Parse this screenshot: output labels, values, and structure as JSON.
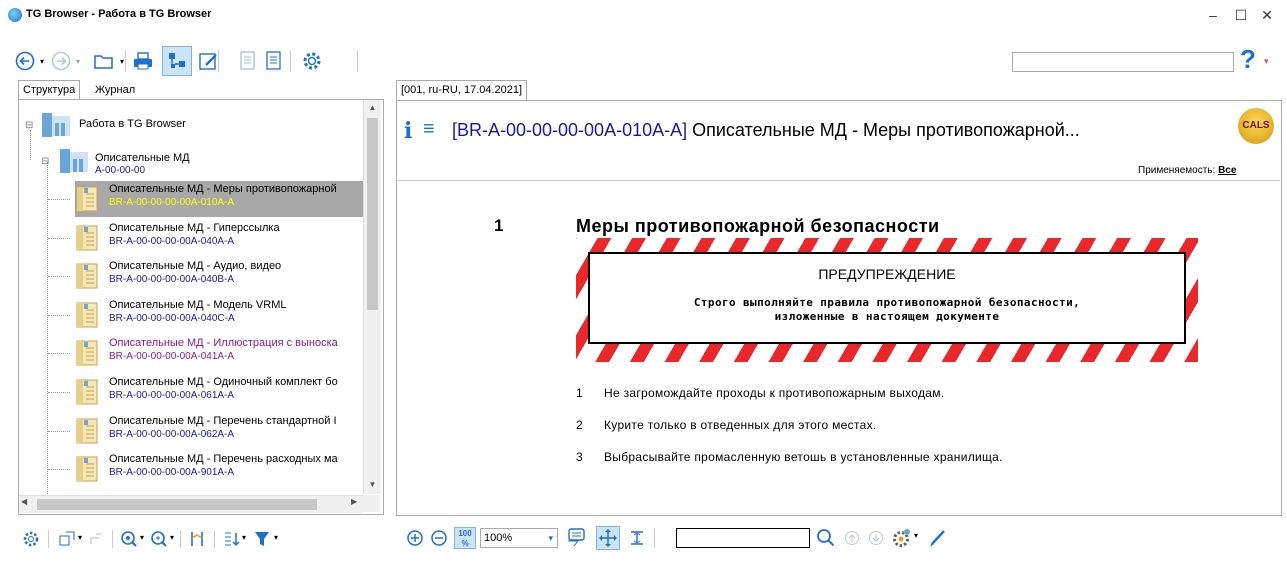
{
  "window": {
    "title": "TG Browser - Работа в TG Browser",
    "controls": {
      "minimize": "–",
      "maximize": "☐",
      "close": "✕"
    }
  },
  "toolbar": {
    "search_value": "",
    "help_label": "?"
  },
  "left_panel": {
    "tabs": [
      {
        "label": "Структура",
        "active": true
      },
      {
        "label": "Журнал",
        "active": false
      }
    ],
    "tree": {
      "root": {
        "label": "Работа в TG Browser",
        "expander": "⊟"
      },
      "folder": {
        "label": "Описательные МД",
        "code": "A-00-00-00",
        "expander": "⊟"
      },
      "items": [
        {
          "label": "Описательные МД - Меры противопожарной",
          "code": "BR-A-00-00-00-00A-010A-A",
          "selected": true
        },
        {
          "label": "Описательные МД - Гиперссылка",
          "code": "BR-A-00-00-00-00A-040A-A",
          "selected": false
        },
        {
          "label": "Описательные МД - Аудио, видео",
          "code": "BR-A-00-00-00-00A-040B-A",
          "selected": false
        },
        {
          "label": "Описательные МД - Модель VRML",
          "code": "BR-A-00-00-00-00A-040C-A",
          "selected": false
        },
        {
          "label": "Описательные МД - Иллюстрация с выноска",
          "code": "BR-A-00-00-00-00A-041A-A",
          "selected": false,
          "visited": true
        },
        {
          "label": "Описательные МД - Одиночный комплект бо",
          "code": "BR-A-00-00-00-00A-061A-A",
          "selected": false
        },
        {
          "label": "Описательные МД - Перечень стандартной I",
          "code": "BR-A-00-00-00-00A-062A-A",
          "selected": false
        },
        {
          "label": "Описательные МД - Перечень расходных ма",
          "code": "BR-A-00-00-00-00A-901A-A",
          "selected": false
        }
      ]
    }
  },
  "document": {
    "tab_label": "[001, ru-RU, 17.04.2021]",
    "code": "[BR-A-00-00-00-00A-010A-A]",
    "title": "Описательные МД - Меры противопожарной...",
    "applicability_label": "Применяемость:",
    "applicability_value": "Все",
    "logo_text": "CALS",
    "section_number": "1",
    "section_title": "Меры противопожарной безопасности",
    "warning": {
      "title": "ПРЕДУПРЕЖДЕНИЕ",
      "line1": "Строго выполняйте правила противопожарной безопасности,",
      "line2": "изложенные в настоящем документе"
    },
    "paragraphs": [
      {
        "num": "1",
        "text": "Не загромождайте проходы к противопожарным выходам."
      },
      {
        "num": "2",
        "text": "Курите только в отведенных для этого местах."
      },
      {
        "num": "3",
        "text": "Выбрасывайте промасленную ветошь в установленные хранилища."
      }
    ]
  },
  "viewer_toolbar": {
    "zoom_value": "100%",
    "fit_label": "100 %",
    "search_value": ""
  },
  "colors": {
    "selection": "#a8a8a8",
    "selected_code": "#ffff00",
    "code_blue": "#1a1aa0",
    "visited": "#8b1a8b",
    "hazard_red": "#e8282b",
    "accent_blue": "#1f6fd0"
  }
}
